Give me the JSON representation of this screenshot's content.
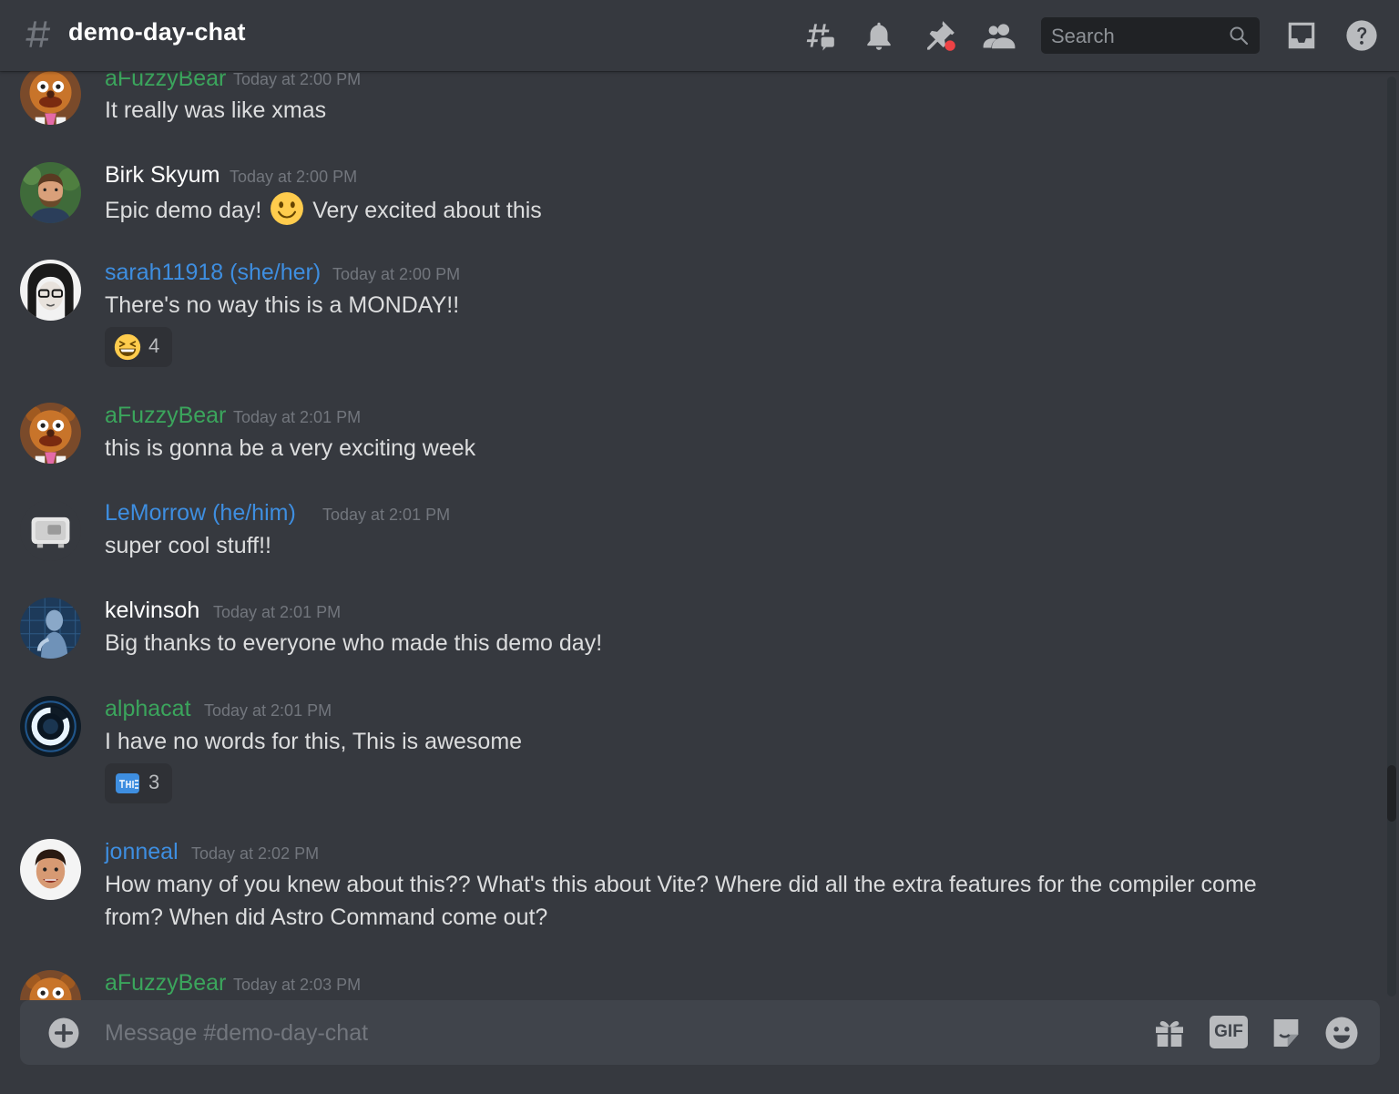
{
  "header": {
    "channel_name": "demo-day-chat",
    "search_placeholder": "Search",
    "icons": [
      "threads-icon",
      "bell-icon",
      "pin-icon",
      "members-icon",
      "inbox-icon",
      "help-icon"
    ]
  },
  "colors": {
    "background": "#36393f",
    "green_name": "#3ba55c",
    "blue_name": "#3e8ee0",
    "white_name": "#ffffff",
    "timestamp": "#72767d",
    "composer_bg": "#40444b"
  },
  "messages": [
    {
      "username": "aFuzzyBear",
      "timestamp": "Today at 2:00 PM",
      "text": "It really was like xmas"
    },
    {
      "username": "Birk Skyum",
      "timestamp": "Today at 2:00 PM",
      "text_before": "Epic demo day!",
      "emoji": "slightly-smiling-face-emoji",
      "text_after": "Very excited about this"
    },
    {
      "username": "sarah11918 (she/her)",
      "timestamp": "Today at 2:00 PM",
      "text": "There's no way this is a MONDAY!!",
      "reaction": {
        "emoji": "grinning-squinting-face-emoji",
        "count": "4"
      }
    },
    {
      "username": "aFuzzyBear",
      "timestamp": "Today at 2:01 PM",
      "text": "this is gonna be a very exciting week"
    },
    {
      "username": "LeMorrow (he/him)",
      "timestamp": "Today at 2:01 PM",
      "text": "super cool stuff!!"
    },
    {
      "username": "kelvinsoh",
      "timestamp": "Today at 2:01 PM",
      "text": "Big thanks to everyone who made this demo day!"
    },
    {
      "username": "alphacat",
      "timestamp": "Today at 2:01 PM",
      "text": "I have no words for this, This is awesome",
      "reaction": {
        "emoji": "custom-this-emoji",
        "count": "3"
      }
    },
    {
      "username": "jonneal",
      "timestamp": "Today at 2:02 PM",
      "text": "How many of you knew about this?? What's this about Vite? Where did all the extra features for the compiler come from? When did Astro Command come out?"
    },
    {
      "username": "aFuzzyBear",
      "timestamp": "Today at 2:03 PM"
    }
  ],
  "composer": {
    "placeholder": "Message #demo-day-chat",
    "icons": [
      "plus-icon",
      "gift-icon",
      "gif-icon",
      "sticker-icon",
      "emoji-icon"
    ],
    "gif_label": "GIF"
  }
}
